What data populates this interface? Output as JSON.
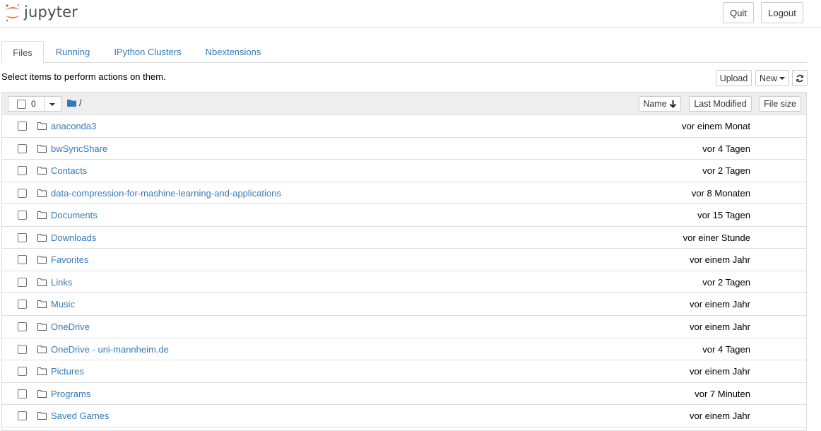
{
  "header": {
    "logo_text": "jupyter",
    "quit_label": "Quit",
    "logout_label": "Logout",
    "accent_color": "#f37726"
  },
  "tabs": [
    {
      "label": "Files",
      "active": true
    },
    {
      "label": "Running",
      "active": false
    },
    {
      "label": "IPython Clusters",
      "active": false
    },
    {
      "label": "Nbextensions",
      "active": false
    }
  ],
  "toolbar": {
    "hint": "Select items to perform actions on them.",
    "upload_label": "Upload",
    "new_label": "New",
    "refresh_icon": "refresh-icon"
  },
  "list_header": {
    "selected_count": "0",
    "breadcrumb": "/",
    "sort_name_label": "Name",
    "sort_modified_label": "Last Modified",
    "sort_size_label": "File size"
  },
  "files": [
    {
      "name": "anaconda3",
      "modified": "vor einem Monat"
    },
    {
      "name": "bwSyncShare",
      "modified": "vor 4 Tagen"
    },
    {
      "name": "Contacts",
      "modified": "vor 2 Tagen"
    },
    {
      "name": "data-compression-for-mashine-learning-and-applications",
      "modified": "vor 8 Monaten"
    },
    {
      "name": "Documents",
      "modified": "vor 15 Tagen"
    },
    {
      "name": "Downloads",
      "modified": "vor einer Stunde"
    },
    {
      "name": "Favorites",
      "modified": "vor einem Jahr"
    },
    {
      "name": "Links",
      "modified": "vor 2 Tagen"
    },
    {
      "name": "Music",
      "modified": "vor einem Jahr"
    },
    {
      "name": "OneDrive",
      "modified": "vor einem Jahr"
    },
    {
      "name": "OneDrive - uni-mannheim.de",
      "modified": "vor 4 Tagen"
    },
    {
      "name": "Pictures",
      "modified": "vor einem Jahr"
    },
    {
      "name": "Programs",
      "modified": "vor 7 Minuten"
    },
    {
      "name": "Saved Games",
      "modified": "vor einem Jahr"
    }
  ]
}
